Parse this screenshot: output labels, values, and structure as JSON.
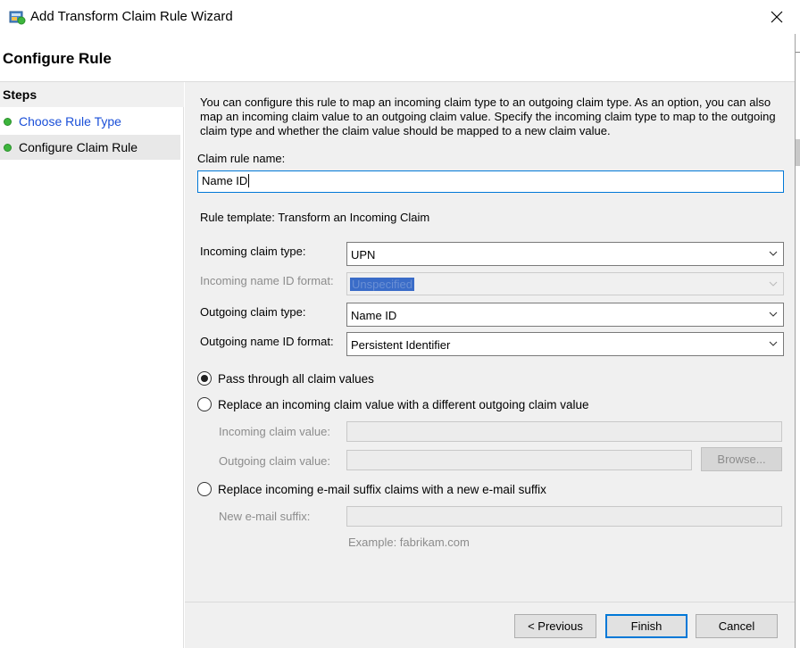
{
  "window": {
    "title": "Add Transform Claim Rule Wizard",
    "icons": {
      "app": "wizard-app-icon",
      "close": "close-icon"
    }
  },
  "page": {
    "title": "Configure Rule"
  },
  "steps": {
    "header": "Steps",
    "items": [
      {
        "label": "Choose Rule Type",
        "state": "completed-link"
      },
      {
        "label": "Configure Claim Rule",
        "state": "current"
      }
    ]
  },
  "main": {
    "description": "You can configure this rule to map an incoming claim type to an outgoing claim type. As an option, you can also map an incoming claim value to an outgoing claim value. Specify the incoming claim type to map to the outgoing claim type and whether the claim value should be mapped to a new claim value.",
    "claim_rule_name_label": "Claim rule name:",
    "claim_rule_name_value": "Name ID",
    "rule_template": "Rule template: Transform an Incoming Claim",
    "incoming_claim_type_label": "Incoming claim type:",
    "incoming_claim_type_value": "UPN",
    "incoming_name_id_format_label": "Incoming name ID format:",
    "incoming_name_id_format_value": "Unspecified",
    "outgoing_claim_type_label": "Outgoing claim type:",
    "outgoing_claim_type_value": "Name ID",
    "outgoing_name_id_format_label": "Outgoing name ID format:",
    "outgoing_name_id_format_value": "Persistent Identifier",
    "options": {
      "pass_through": "Pass through all claim values",
      "replace_value": "Replace an incoming claim value with a different outgoing claim value",
      "replace_suffix": "Replace incoming e-mail suffix claims with a new e-mail suffix",
      "selected": "pass_through"
    },
    "incoming_claim_value_label": "Incoming claim value:",
    "outgoing_claim_value_label": "Outgoing claim value:",
    "browse_label": "Browse...",
    "new_email_suffix_label": "New e-mail suffix:",
    "example_text": "Example: fabrikam.com"
  },
  "footer": {
    "previous_label": "< Previous",
    "finish_label": "Finish",
    "cancel_label": "Cancel"
  },
  "colors": {
    "accent": "#0078d7",
    "link": "#1a4fd8",
    "step_done": "#3db53d",
    "panel_bg": "#f0f0f0"
  }
}
